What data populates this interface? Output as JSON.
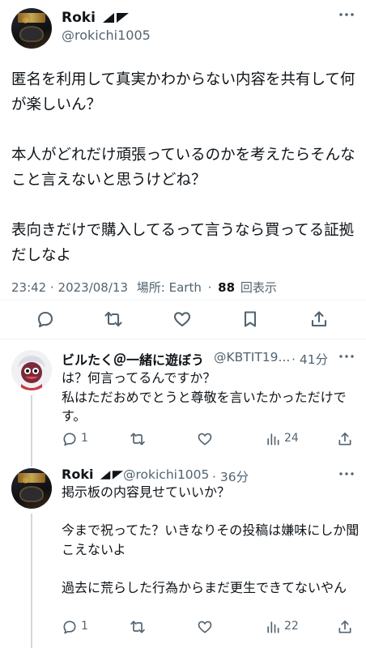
{
  "main_tweet": {
    "author_name": "Roki",
    "author_handle": "@rokichi1005",
    "text": "匿名を利用して真実かわからない内容を共有して何が楽しいん？\n\n本人がどれだけ頑張っているのかを考えたらそんなこと言えないと思うけどね？\n\n表向きだけで購入してるって言うなら買ってる証拠だしなよ",
    "timestamp": "23:42 · 2023/08/13",
    "location_label": "場所: Earth",
    "separator": "·",
    "views_count": "88",
    "views_label": "回表示"
  },
  "replies": [
    {
      "author_name": "ビルたく＠一緒に遊ぼう",
      "author_handle": "@KBTIT19...",
      "time": "· 41分",
      "text": "は？何言ってるんですか？\n私はただおめでとうと尊敬を言いたかっただけです。",
      "reply_count": "1",
      "views": "24"
    },
    {
      "author_name": "Roki",
      "author_handle": "@rokichi1005",
      "time": "· 36分",
      "text": "掲示板の内容見せていいか？\n\n今まで祝ってた？いきなりその投稿は嫌味にしか聞こえないよ\n\n過去に荒らした行為からまだ更生できてないやん",
      "reply_count": "1",
      "views": "22"
    }
  ],
  "icons": [
    "reply-icon",
    "retweet-icon",
    "like-icon",
    "bookmark-icon",
    "share-icon",
    "views-icon",
    "more-icon",
    "flag-icon"
  ]
}
